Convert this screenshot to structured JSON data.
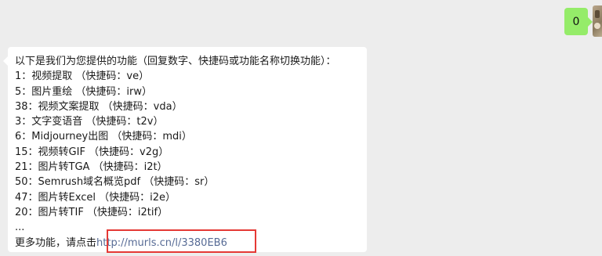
{
  "sent_message": {
    "text": "0"
  },
  "received_message": {
    "intro": "以下是我们为您提供的功能（回复数字、快捷码或功能名称切换功能）：",
    "features": [
      "1：视频提取 （快捷码：ve）",
      "5：图片重绘 （快捷码：irw）",
      "38：视频文案提取 （快捷码：vda）",
      "3：文字变语音 （快捷码：t2v）",
      "6：Midjourney出图 （快捷码：mdi）",
      "15：视频转GIF （快捷码：v2g）",
      "21：图片转TGA （快捷码：i2t）",
      "50：Semrush域名概览pdf （快捷码：sr）",
      "47：图片转Excel （快捷码：i2e）",
      "20：图片转TIF （快捷码：i2tif）"
    ],
    "ellipsis": "...",
    "more_prefix": "更多功能，请点击",
    "more_link": "http://murls.cn/l/3380EB6"
  }
}
